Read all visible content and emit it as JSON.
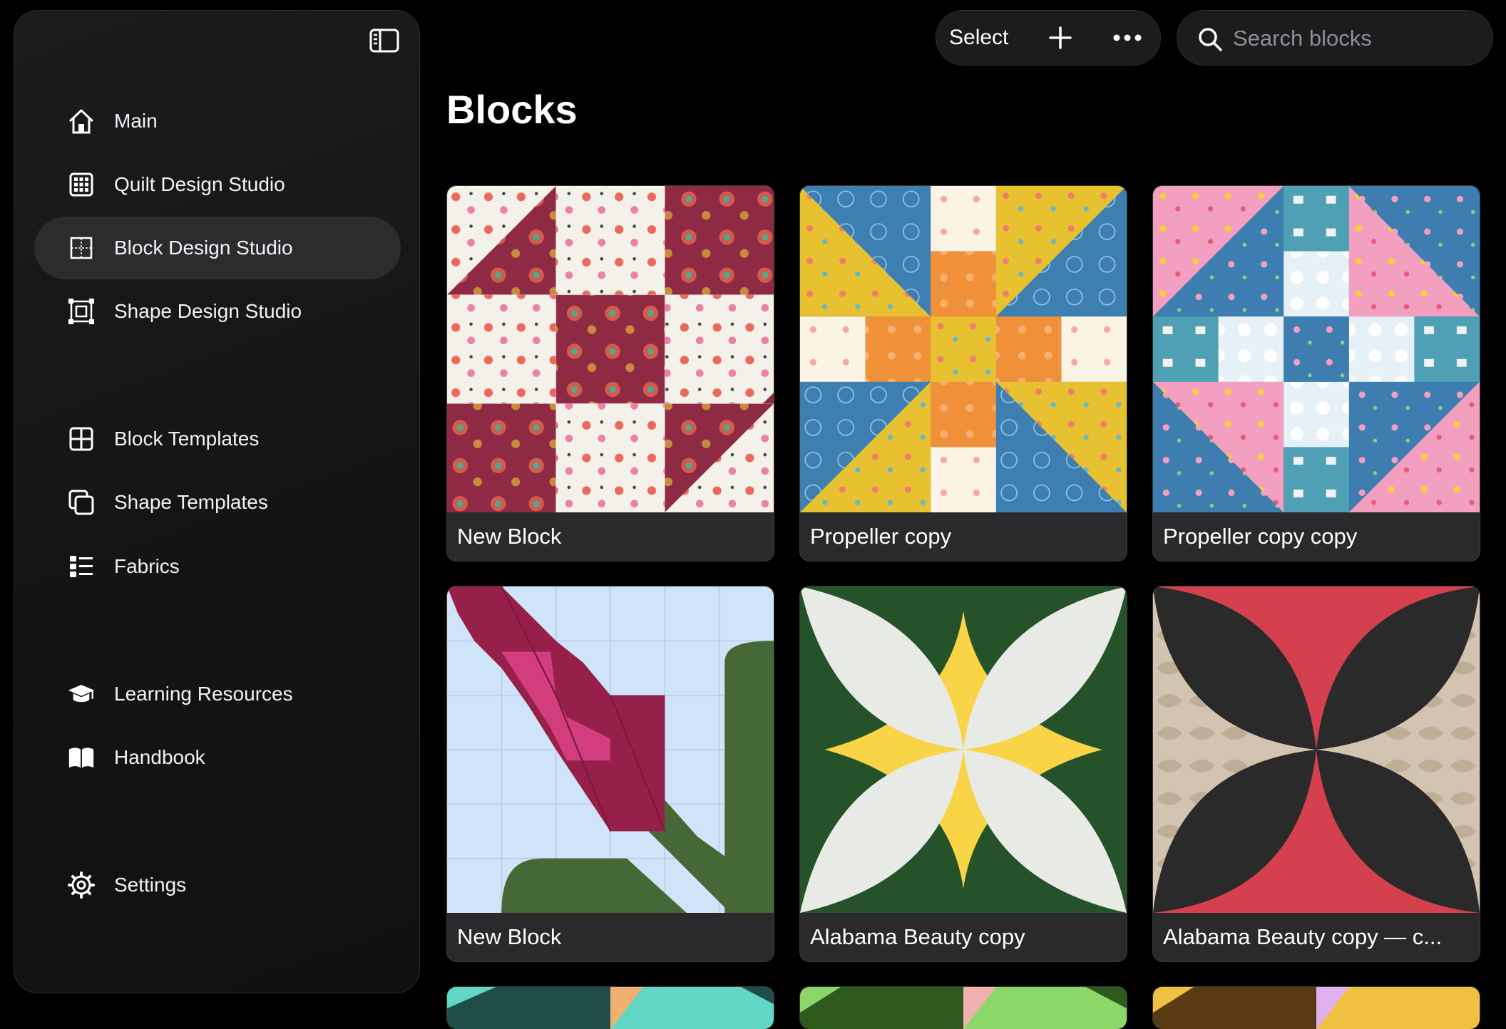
{
  "sidebar": {
    "items": [
      {
        "label": "Main",
        "icon": "house-icon"
      },
      {
        "label": "Quilt Design Studio",
        "icon": "grid-icon"
      },
      {
        "label": "Block Design Studio",
        "icon": "block-design-icon",
        "active": true
      },
      {
        "label": "Shape Design Studio",
        "icon": "shape-design-icon"
      },
      {
        "label": "Block Templates",
        "icon": "block-templates-icon"
      },
      {
        "label": "Shape Templates",
        "icon": "shape-templates-icon"
      },
      {
        "label": "Fabrics",
        "icon": "list-icon"
      },
      {
        "label": "Learning Resources",
        "icon": "graduation-cap-icon"
      },
      {
        "label": "Handbook",
        "icon": "book-icon"
      },
      {
        "label": "Settings",
        "icon": "gear-icon"
      }
    ]
  },
  "toolbar": {
    "select_label": "Select",
    "add_icon": "plus-icon",
    "more_icon": "ellipsis-icon"
  },
  "search": {
    "placeholder": "Search blocks"
  },
  "page": {
    "title": "Blocks"
  },
  "blocks": [
    {
      "name": "New Block"
    },
    {
      "name": "Propeller copy"
    },
    {
      "name": "Propeller copy copy"
    },
    {
      "name": "New Block"
    },
    {
      "name": "Alabama Beauty copy"
    },
    {
      "name": "Alabama  Beauty copy — c..."
    }
  ],
  "colors": {
    "accent_active": "#2c2c2e",
    "burgundy": "#8f2a45",
    "cream": "#f4f0ea",
    "blue": "#3d7fb1",
    "yellow": "#e7c12f",
    "orange": "#f0913a",
    "pink": "#f3a0c0",
    "teal": "#4fa0b4",
    "sky": "#cfe4f8",
    "tulip": "#97204b",
    "leaf": "#456837",
    "forest": "#265229",
    "gold": "#f8d446",
    "petal": "#e8eae5",
    "red": "#d4404e",
    "charcoal": "#2a2a2a",
    "tan": "#d2c4b0"
  }
}
